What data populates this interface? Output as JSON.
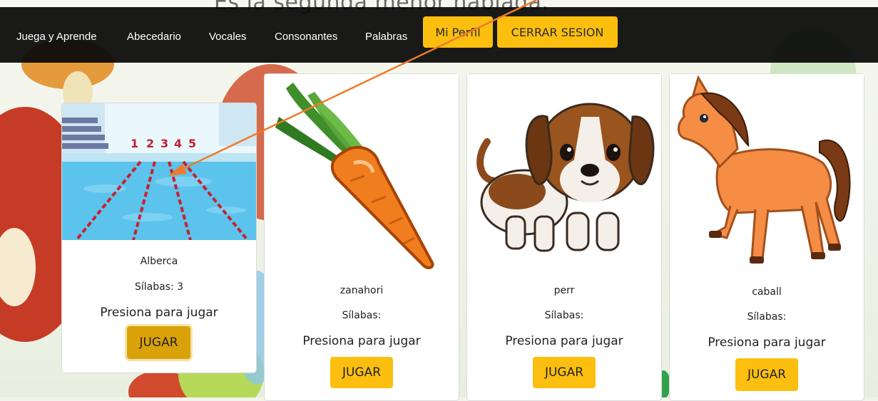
{
  "background_title": "Es la segunda menor                                   hablada.",
  "nav": {
    "links": [
      "Juega y Aprende",
      "Abecedario",
      "Vocales",
      "Consonantes",
      "Palabras"
    ],
    "profile_label": "Mi Perfil",
    "logout_label": "CERRAR SESION"
  },
  "cards": [
    {
      "word": "Alberca",
      "syllables": "Sílabas: 3",
      "prompt": "Presiona para jugar",
      "button": "JUGAR",
      "image": "swimming-pool-image"
    },
    {
      "word": "zanahori",
      "syllables": "Sílabas:",
      "prompt": "Presiona para jugar",
      "button": "JUGAR",
      "image": "carrot-image"
    },
    {
      "word": "perr",
      "syllables": "Sílabas:",
      "prompt": "Presiona para jugar",
      "button": "JUGAR",
      "image": "puppy-image"
    },
    {
      "word": "caball",
      "syllables": "Sílabas:",
      "prompt": "Presiona para jugar",
      "button": "JUGAR",
      "image": "horse-image"
    }
  ],
  "colors": {
    "accent": "#fcbf0f",
    "navbar": "#080808",
    "annotation_arrow": "#f07a2a"
  }
}
